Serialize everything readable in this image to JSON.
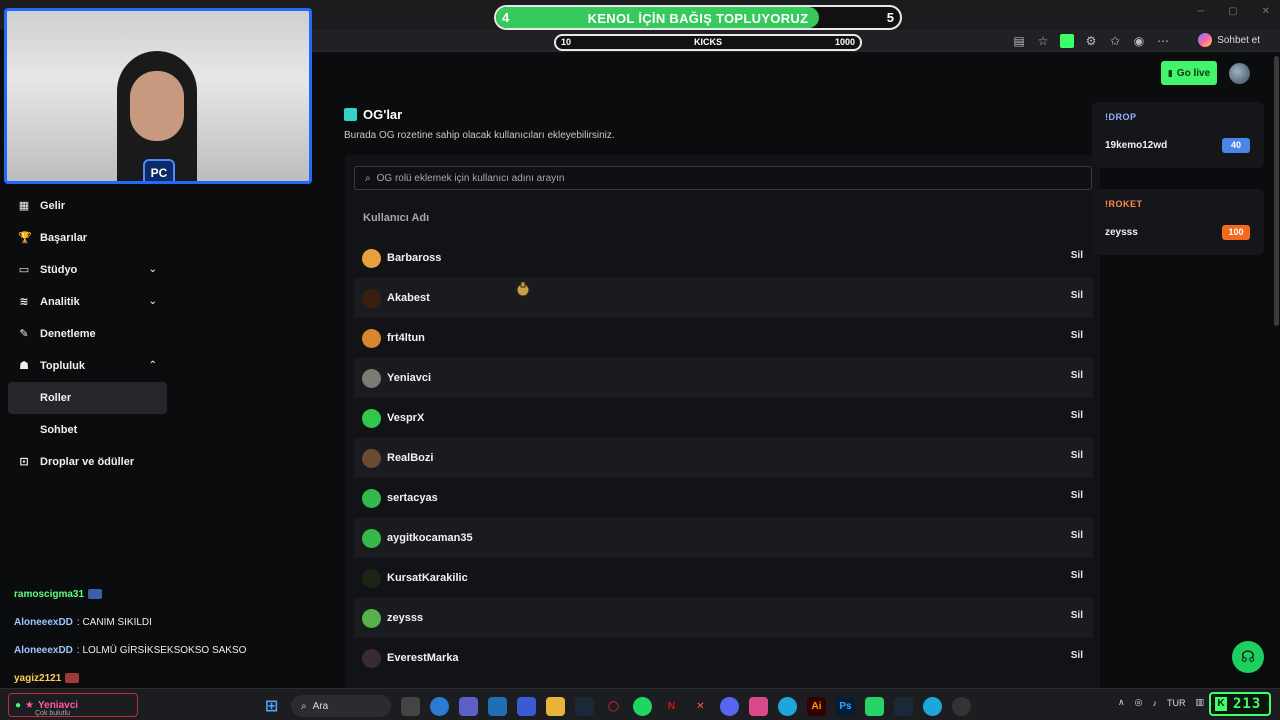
{
  "browser": {
    "chat_button": "Sohbet et"
  },
  "overlay": {
    "donation": {
      "title": "KENOL İÇİN BAĞIŞ TOPLUYORUZ",
      "min": "4",
      "max": "5",
      "progress": 0.8
    },
    "kicks": {
      "min": "10",
      "label": "KICKS",
      "max": "1000"
    },
    "cam_logo": "PC"
  },
  "sidebar": {
    "items": [
      {
        "label": "Gelir",
        "icon": "chart-icon"
      },
      {
        "label": "Başarılar",
        "icon": "trophy-icon"
      },
      {
        "label": "Stüdyo",
        "icon": "studio-icon",
        "expandable": true
      },
      {
        "label": "Analitik",
        "icon": "analytics-icon",
        "expandable": true
      },
      {
        "label": "Denetleme",
        "icon": "wrench-icon"
      },
      {
        "label": "Topluluk",
        "icon": "community-icon",
        "expanded": true
      }
    ],
    "subitems": [
      {
        "label": "Roller",
        "active": true
      },
      {
        "label": "Sohbet",
        "active": false
      }
    ],
    "last_item": {
      "label": "Droplar ve ödüller",
      "icon": "gift-icon"
    }
  },
  "overlay_chat": [
    {
      "user": "ramoscigma31",
      "user_color": "#5dff7a",
      "message": "",
      "badge": "blue"
    },
    {
      "user": "AloneeexDD",
      "user_color": "#9fc4ff",
      "message": ": CANIM SIKILDI"
    },
    {
      "user": "AloneeexDD",
      "user_color": "#9fc4ff",
      "message": ": LOLMÜ GİRSİKSEKSOKSO SAKSO"
    },
    {
      "user": "yagiz2121",
      "user_color": "#ffd05a",
      "message": "",
      "badge": "red"
    }
  ],
  "header": {
    "go_live": "Go live"
  },
  "page": {
    "title": "OG'lar",
    "subtitle": "Burada OG rozetine sahip olacak kullanıcıları ekleyebilirsiniz.",
    "search_placeholder": "OG rolü eklemek için kullanıcı adını arayın",
    "column_header": "Kullanıcı Adı",
    "delete_label": "Sil",
    "users": [
      {
        "name": "Barbaross",
        "avatar_color": "#e6a03c"
      },
      {
        "name": "Akabest",
        "avatar_color": "#3a1e12"
      },
      {
        "name": "frt4ltun",
        "avatar_color": "#d9862f"
      },
      {
        "name": "Yeniavci",
        "avatar_color": "#7d7a76"
      },
      {
        "name": "VesprX",
        "avatar_color": "#2fc84c"
      },
      {
        "name": "RealBozi",
        "avatar_color": "#6b4a32"
      },
      {
        "name": "sertacyas",
        "avatar_color": "#35b94a"
      },
      {
        "name": "aygitkocaman35",
        "avatar_color": "#35b94a"
      },
      {
        "name": "KursatKarakilic",
        "avatar_color": "#1e2414"
      },
      {
        "name": "zeysss",
        "avatar_color": "#58b04a"
      },
      {
        "name": "EverestMarka",
        "avatar_color": "#3a2a36"
      }
    ]
  },
  "widgets": [
    {
      "title": "!DROP",
      "title_color": "#8fb4ff",
      "user": "19kemo12wd",
      "value": "40",
      "badge_color": "#4a86e8"
    },
    {
      "title": "!ROKET",
      "title_color": "#ff8a4a",
      "user": "zeysss",
      "value": "100",
      "badge_color": "#f26a1b"
    }
  ],
  "taskbar": {
    "stream_user": "Yeniavci",
    "stream_sub": "Çok bulutlu",
    "search_label": "Ara",
    "lang": "TUR",
    "kick_count": "213"
  }
}
